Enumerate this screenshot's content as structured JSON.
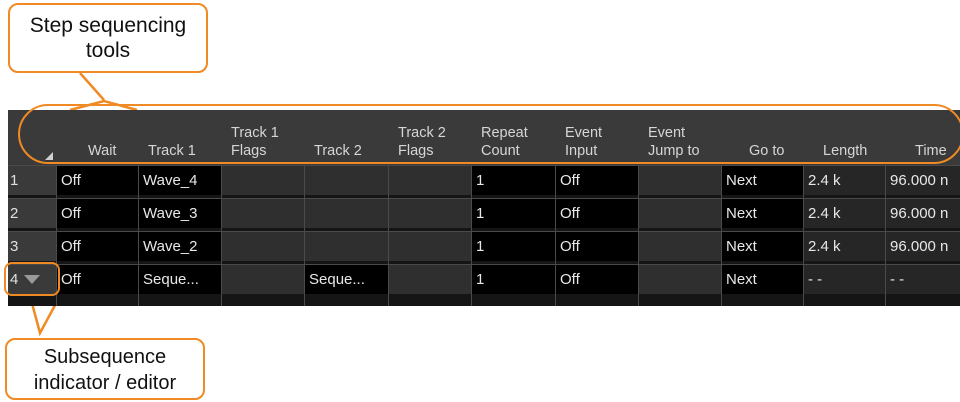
{
  "callouts": {
    "top": [
      "Step sequencing",
      "tools"
    ],
    "bottom": [
      "Subsequence",
      "indicator / editor"
    ]
  },
  "columns": [
    {
      "l1": "",
      "l2": "Wait"
    },
    {
      "l1": "",
      "l2": "Track 1"
    },
    {
      "l1": "Track 1",
      "l2": "Flags"
    },
    {
      "l1": "",
      "l2": "Track 2"
    },
    {
      "l1": "Track 2",
      "l2": "Flags"
    },
    {
      "l1": "Repeat",
      "l2": "Count"
    },
    {
      "l1": "Event",
      "l2": "Input"
    },
    {
      "l1": "Event",
      "l2": "Jump to"
    },
    {
      "l1": "",
      "l2": "Go to"
    },
    {
      "l1": "",
      "l2": "Length"
    },
    {
      "l1": "",
      "l2": "Time"
    }
  ],
  "rows": [
    {
      "num": "1",
      "cells": [
        "Off",
        "Wave_4",
        "",
        "",
        "",
        "1",
        "Off",
        "",
        "Next",
        "2.4 k",
        "96.000 n"
      ]
    },
    {
      "num": "2",
      "cells": [
        "Off",
        "Wave_3",
        "",
        "",
        "",
        "1",
        "Off",
        "",
        "Next",
        "2.4 k",
        "96.000 n"
      ]
    },
    {
      "num": "3",
      "cells": [
        "Off",
        "Wave_2",
        "",
        "",
        "",
        "1",
        "Off",
        "",
        "Next",
        "2.4 k",
        "96.000 n"
      ]
    },
    {
      "num": "4",
      "cells": [
        "Off",
        "Seque...",
        "",
        "Seque...",
        "",
        "1",
        "Off",
        "",
        "Next",
        "- -",
        "- -"
      ]
    }
  ],
  "icons": {
    "corner": "triangle-corner-icon",
    "subsequence": "dropdown-triangle-icon"
  },
  "colors": {
    "accent": "#f08a24",
    "header_bg": "#3a3a3a",
    "cell_black": "#000000",
    "cell_gray": "#2f2f2f"
  }
}
